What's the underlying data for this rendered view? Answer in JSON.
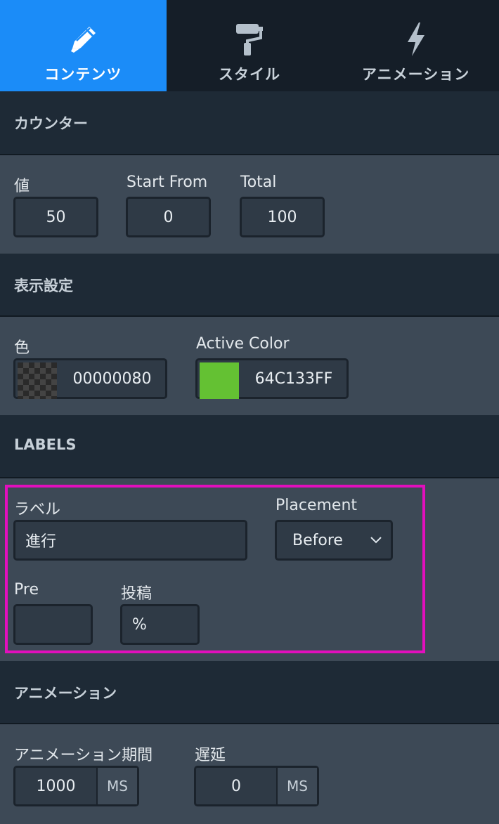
{
  "tabs": [
    {
      "label": "コンテンツ",
      "icon": "pencil-icon",
      "active": true
    },
    {
      "label": "スタイル",
      "icon": "paint-roller-icon",
      "active": false
    },
    {
      "label": "アニメーション",
      "icon": "lightning-icon",
      "active": false
    }
  ],
  "counter": {
    "heading": "カウンター",
    "value_label": "値",
    "value": "50",
    "start_label": "Start From",
    "start": "0",
    "total_label": "Total",
    "total": "100"
  },
  "display": {
    "heading": "表示設定",
    "color_label": "色",
    "color_value": "00000080",
    "active_color_label": "Active Color",
    "active_color_value": "64C133FF",
    "active_color_hex": "#64c133"
  },
  "labels": {
    "heading": "LABELS",
    "label_label": "ラベル",
    "label_value": "進行",
    "placement_label": "Placement",
    "placement_value": "Before",
    "pre_label": "Pre",
    "pre_value": "",
    "post_label": "投稿",
    "post_value": "%"
  },
  "animation": {
    "heading": "アニメーション",
    "duration_label": "アニメーション期間",
    "duration_value": "1000",
    "duration_unit": "MS",
    "delay_label": "遅延",
    "delay_value": "0",
    "delay_unit": "MS"
  },
  "colors": {
    "accent": "#1b8cf8",
    "highlight": "#e20fbd"
  }
}
